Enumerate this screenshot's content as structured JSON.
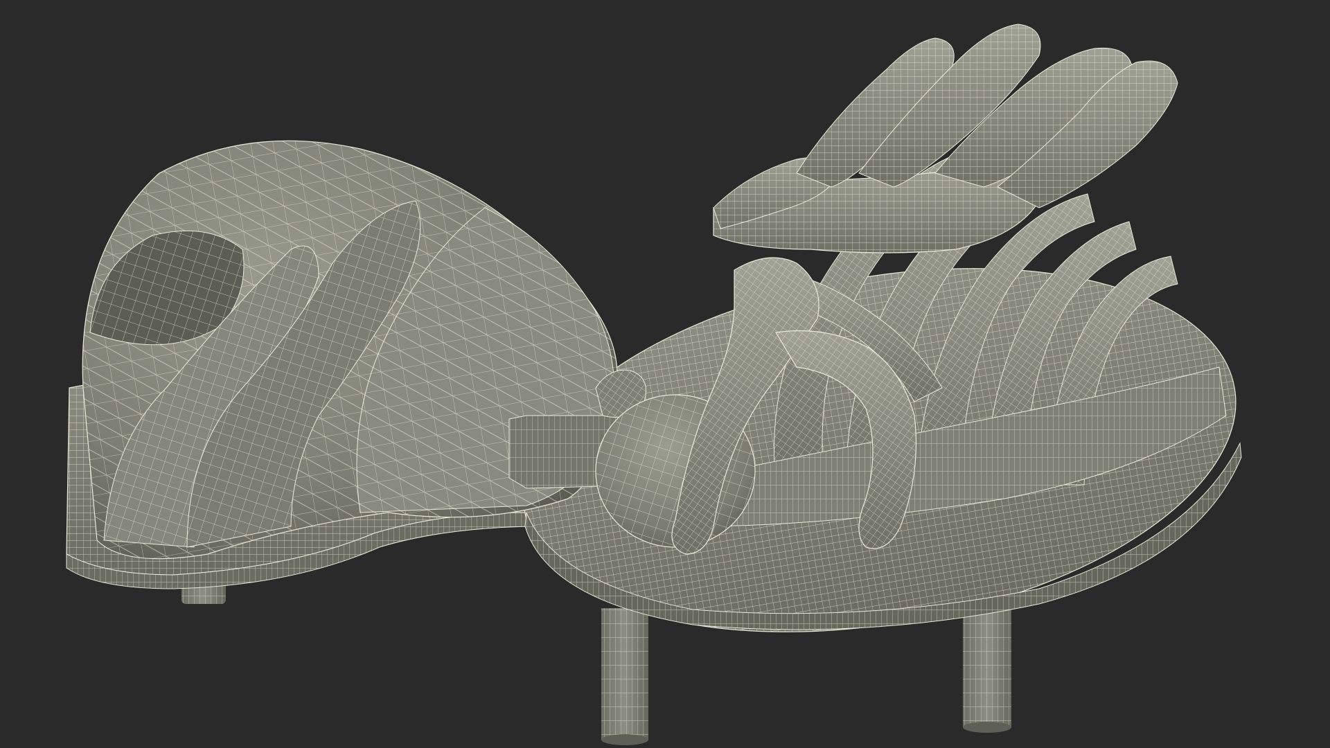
{
  "scene": {
    "background_color": "#2a2a2a",
    "model_fill_light": "#8e8f84",
    "model_fill_mid": "#7a7b70",
    "model_fill_dark": "#55564d",
    "wire_color": "#e9ead8"
  }
}
